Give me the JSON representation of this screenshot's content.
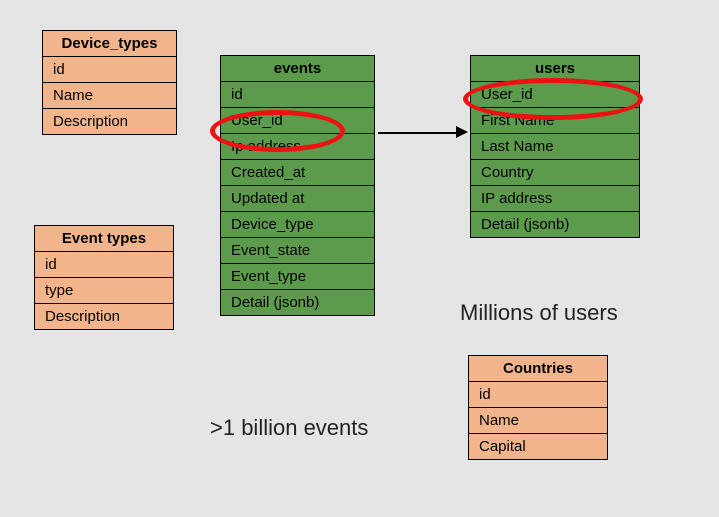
{
  "tables": {
    "device_types": {
      "title": "Device_types",
      "rows": [
        "id",
        "Name",
        "Description"
      ]
    },
    "event_types": {
      "title": "Event types",
      "rows": [
        "id",
        "type",
        "Description"
      ]
    },
    "events": {
      "title": "events",
      "rows": [
        "id",
        "User_id",
        "Ip address",
        "Created_at",
        "Updated at",
        "Device_type",
        "Event_state",
        "Event_type",
        "Detail (jsonb)"
      ]
    },
    "users": {
      "title": "users",
      "rows": [
        "User_id",
        "First Name",
        "Last Name",
        "Country",
        "IP address",
        "Detail (jsonb)"
      ]
    },
    "countries": {
      "title": "Countries",
      "rows": [
        "id",
        "Name",
        "Capital"
      ]
    }
  },
  "captions": {
    "events": ">1 billion events",
    "users": "Millions of users"
  }
}
